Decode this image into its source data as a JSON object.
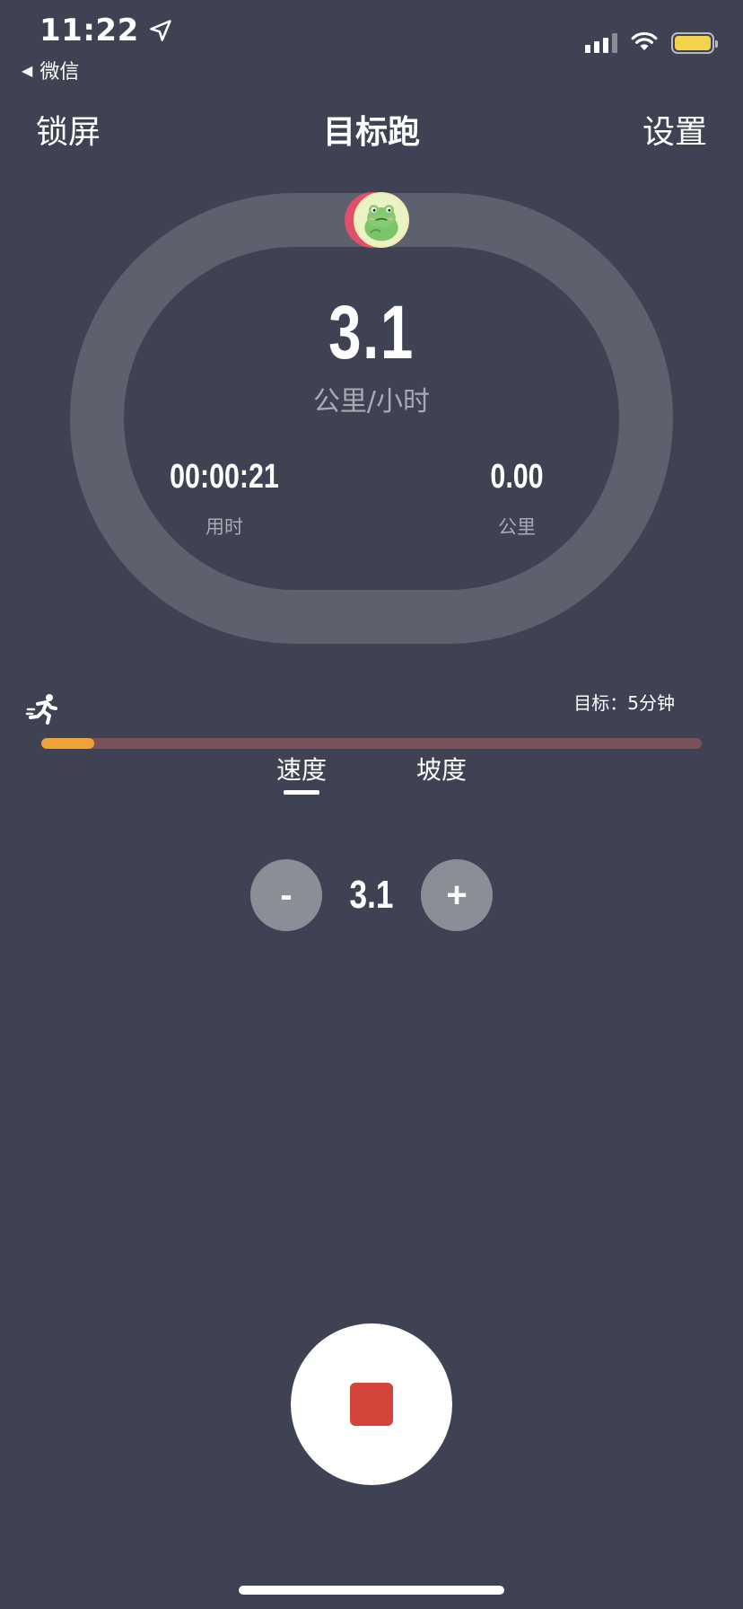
{
  "status_bar": {
    "time": "11:22",
    "back_app": "微信"
  },
  "nav": {
    "left": "锁屏",
    "title": "目标跑",
    "right": "设置"
  },
  "dashboard": {
    "speed": "3.1",
    "speed_unit": "公里/小时",
    "elapsed_time": "00:00:21",
    "elapsed_label": "用时",
    "distance": "0.00",
    "distance_label": "公里"
  },
  "goal": {
    "text": "目标：5分钟",
    "progress_percent": 8
  },
  "tabs": [
    {
      "label": "速度",
      "active": true
    },
    {
      "label": "坡度",
      "active": false
    }
  ],
  "stepper": {
    "minus_label": "-",
    "value": "3.1",
    "plus_label": "+"
  },
  "colors": {
    "background": "#3f4252",
    "track": "#5d606d",
    "progress_fill": "#f0a23a",
    "progress_track": "#7a5158",
    "stop_square": "#d5443a",
    "battery": "#f4d34a"
  },
  "icons": {
    "location": "location-arrow-icon",
    "runner": "runner-icon",
    "avatar": "frog-avatar-icon"
  }
}
